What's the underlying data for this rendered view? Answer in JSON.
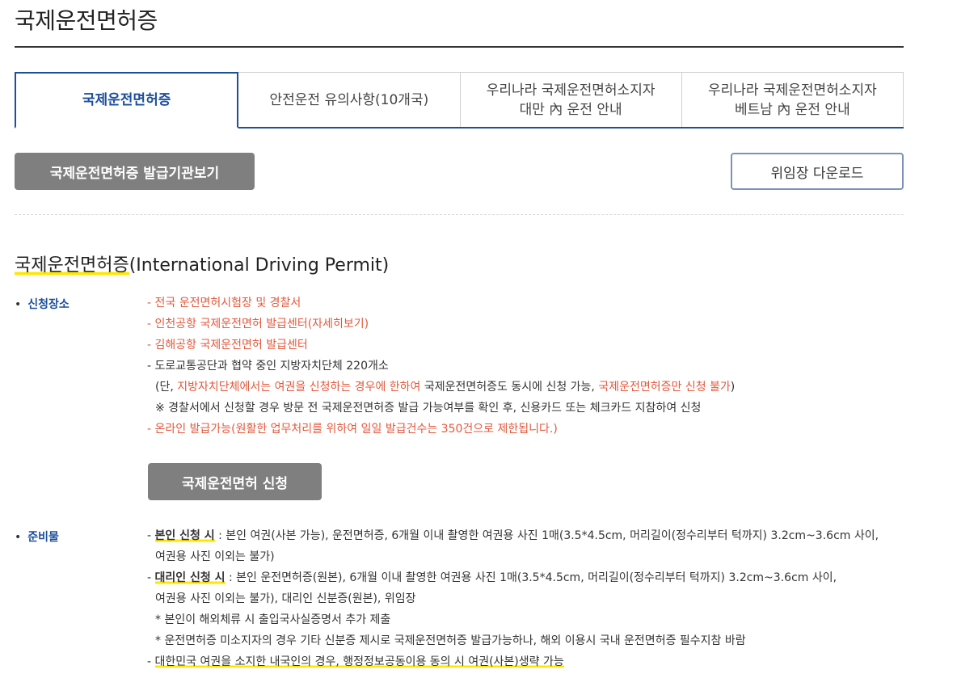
{
  "page_title": "국제운전면허증",
  "tabs": [
    {
      "line1": "국제운전면허증",
      "line2": "",
      "active": true
    },
    {
      "line1": "안전운전 유의사항(10개국)",
      "line2": ""
    },
    {
      "line1": "우리나라 국제운전면허소지자",
      "line2": "대만 內 운전 안내"
    },
    {
      "line1": "우리나라 국제운전면허소지자",
      "line2": "베트남 內 운전 안내"
    }
  ],
  "buttons": {
    "issuer": "국제운전면허증 발급기관보기",
    "download": "위임장 다운로드",
    "apply": "국제운전면허 신청"
  },
  "section_title_hl": "국제운전면허증",
  "section_title_rest": "(International Driving Permit)",
  "apply_place": {
    "label": "신청장소",
    "l1": "- 전국 운전면허시험장 및 경찰서",
    "l2": "- 인천공항 국제운전면허 발급센터(자세히보기)",
    "l3": "- 김해공항 국제운전면허 발급센터",
    "l4": "- 도로교통공단과 협약 중인 지방자치단체 220개소",
    "l5a": "(단, ",
    "l5b": "지방자치단체에서는 여권을 신청하는 경우에 한하여",
    "l5c": " 국제운전면허증도 동시에 신청 가능, ",
    "l5d": "국제운전면허증만 신청 불가",
    "l5e": ")",
    "l6": "※ 경찰서에서 신청할 경우 방문 전 국제운전면허증 발급 가능여부를 확인 후, 신용카드 또는 체크카드 지참하여 신청",
    "l7": "- 온라인 발급가능(원활한 업무처리를 위하여 일일 발급건수는 350건으로 제한됩니다.)"
  },
  "prep": {
    "label": "준비물",
    "self_label": "본인 신청 시",
    "self_text": " : 본인 여권(사본 가능), 운전면허증, 6개월 이내 촬영한 여권용 사진 1매(3.5*4.5cm, 머리길이(정수리부터 턱까지) 3.2cm~3.6cm 사이,",
    "self_text2": "여권용 사진 이외는 불가)",
    "proxy_label": "대리인 신청 시",
    "proxy_text": " : 본인 운전면허증(원본), 6개월 이내 촬영한 여권용 사진 1매(3.5*4.5cm, 머리길이(정수리부터 턱까지) 3.2cm~3.6cm 사이,",
    "proxy_text2": "여권용 사진 이외는 불가), 대리인 신분증(원본), 위임장",
    "note1": "* 본인이 해외체류 시 출입국사실증명서 추가 제출",
    "note2": "* 운전면허증 미소지자의 경우 기타 신분증 제시로 국제운전면허증 발급가능하나, 해외 이용시 국내 운전면허증 필수지참 바람",
    "last": "대한민국 여권을 소지한 내국인의 경우, 행정정보공동이용 동의 시 여권(사본)생략 가능"
  },
  "colors": {
    "accent": "#1c4f9c",
    "red": "#e3583c",
    "highlight": "#ffe600",
    "gray_button": "#7f7f7f"
  }
}
